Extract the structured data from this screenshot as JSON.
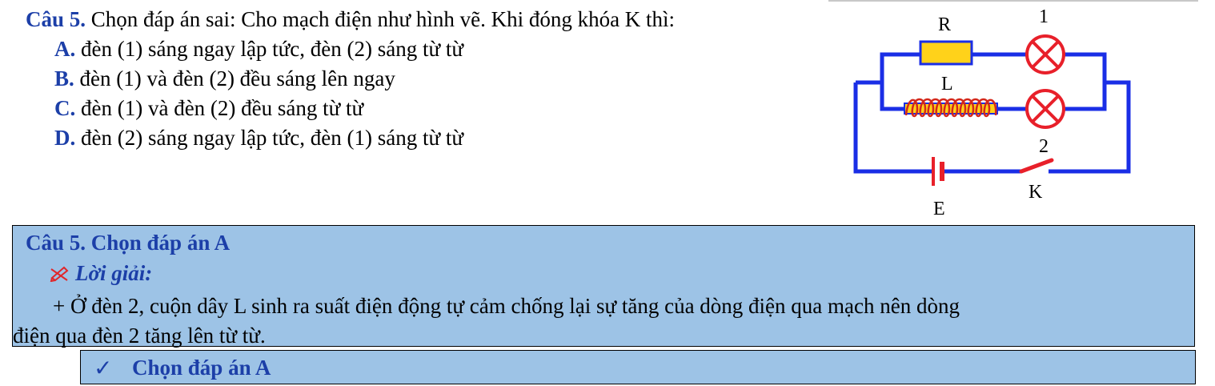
{
  "question": {
    "number": "Câu 5.",
    "text": " Chọn đáp án sai: Cho mạch điện như hình vẽ. Khi đóng khóa K thì:",
    "options": [
      {
        "label": "A.",
        "text": " đèn (1) sáng ngay lập tức, đèn (2) sáng từ từ"
      },
      {
        "label": "B.",
        "text": " đèn (1) và đèn (2) đều sáng lên ngay"
      },
      {
        "label": "C.",
        "text": " đèn (1) và đèn (2) đều sáng từ từ"
      },
      {
        "label": "D.",
        "text": " đèn (2) sáng ngay lập tức, đèn (1) sáng từ từ"
      }
    ]
  },
  "circuit": {
    "labels": {
      "resistor": "R",
      "lamp1": "1",
      "inductor": "L",
      "lamp2": "2",
      "source": "E",
      "switch": "K"
    },
    "colors": {
      "wire": "#1a2ee6",
      "resistor": "#ffd21a",
      "lamp": "#e8202a",
      "coil": "#d4281a",
      "switch": "#e8202a"
    }
  },
  "answer": {
    "title": "Câu 5. Chọn đáp án A",
    "solution_heading": "Lời giải:",
    "solution_first": "+ Ở đèn 2, cuộn dây L sinh ra suất điện động tự cảm chống lại sự tăng của dòng điện qua mạch nên dòng",
    "solution_second": "điện qua đèn 2 tăng lên từ từ.",
    "check_symbol": "✓",
    "final": "Chọn đáp án A"
  },
  "colors": {
    "heading_blue": "#1c3fa8",
    "box_bg": "#9dc3e6"
  }
}
